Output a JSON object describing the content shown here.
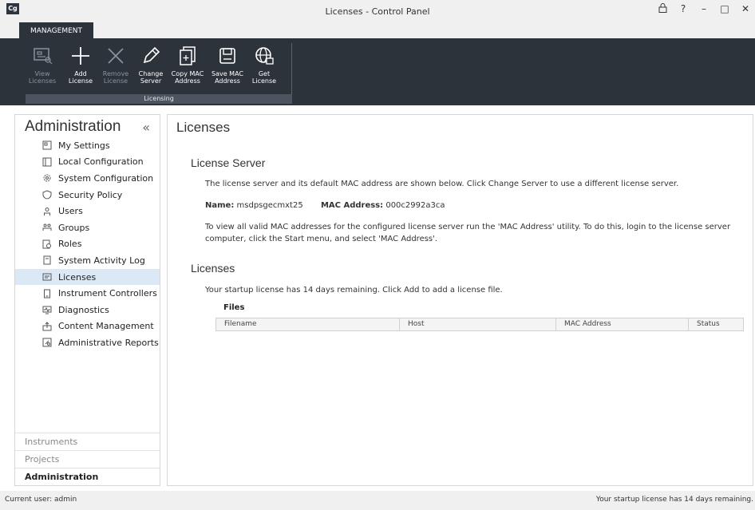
{
  "window": {
    "logo": "Cg",
    "title": "Licenses - Control Panel",
    "controls": [
      "lock",
      "?",
      "–",
      "□",
      "✕"
    ]
  },
  "ribbon": {
    "tab": "MANAGEMENT",
    "group_label": "Licensing",
    "buttons": [
      {
        "line1": "View",
        "line2": "Licenses",
        "icon": "view-licenses-icon",
        "enabled": false
      },
      {
        "line1": "Add",
        "line2": "License",
        "icon": "plus-icon",
        "enabled": true
      },
      {
        "line1": "Remove",
        "line2": "License",
        "icon": "x-icon",
        "enabled": false
      },
      {
        "line1": "Change",
        "line2": "Server",
        "icon": "pencil-icon",
        "enabled": true
      },
      {
        "line1": "Copy MAC",
        "line2": "Address",
        "icon": "copy-icon",
        "enabled": true
      },
      {
        "line1": "Save MAC",
        "line2": "Address",
        "icon": "save-icon",
        "enabled": true
      },
      {
        "line1": "Get",
        "line2": "License",
        "icon": "globe-icon",
        "enabled": true
      }
    ]
  },
  "nav": {
    "header": "Administration",
    "collapse": "«",
    "items": [
      {
        "label": "My Settings",
        "icon": "settings-icon"
      },
      {
        "label": "Local Configuration",
        "icon": "local-config-icon"
      },
      {
        "label": "System Configuration",
        "icon": "gear-icon"
      },
      {
        "label": "Security Policy",
        "icon": "shield-icon"
      },
      {
        "label": "Users",
        "icon": "user-icon"
      },
      {
        "label": "Groups",
        "icon": "group-icon"
      },
      {
        "label": "Roles",
        "icon": "roles-icon"
      },
      {
        "label": "System Activity Log",
        "icon": "log-icon"
      },
      {
        "label": "Licenses",
        "icon": "license-icon",
        "selected": true
      },
      {
        "label": "Instrument Controllers",
        "icon": "controller-icon"
      },
      {
        "label": "Diagnostics",
        "icon": "diagnostics-icon"
      },
      {
        "label": "Content Management",
        "icon": "content-icon"
      },
      {
        "label": "Administrative Reports",
        "icon": "report-icon"
      }
    ],
    "sections": [
      "Instruments",
      "Projects",
      "Administration"
    ]
  },
  "content": {
    "title": "Licenses",
    "server_title": "License Server",
    "server_desc": "The license server and its default MAC address are shown below. Click Change Server to use a different license server.",
    "name_label": "Name:",
    "name_value": "msdpsgecmxt25",
    "mac_label": "MAC Address:",
    "mac_value": "000c2992a3ca",
    "mac_help": "To view all valid MAC addresses for the configured license server run the 'MAC Address' utility.  To do this, login to the license server computer, click the Start menu, and select 'MAC Address'.",
    "licenses_title": "Licenses",
    "startup_text": "Your startup license has 14 days remaining. Click Add to add a license file.",
    "files_label": "Files",
    "columns": [
      "Filename",
      "Host",
      "MAC Address",
      "Status"
    ]
  },
  "status": {
    "left": "Current user: admin",
    "right": "Your startup license has 14 days remaining."
  }
}
